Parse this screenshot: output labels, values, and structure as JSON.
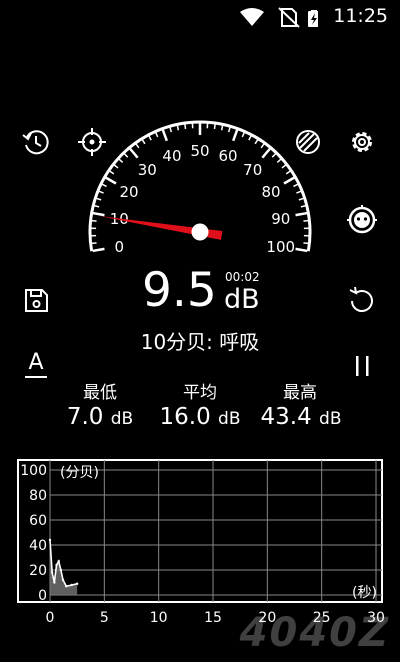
{
  "status_bar": {
    "time": "11:25",
    "icons": [
      "wifi-icon",
      "no-sim-icon",
      "battery-charging-icon"
    ]
  },
  "toolbar": {
    "left_icons": [
      "history-icon",
      "target-icon",
      "save-icon",
      "a-weighting-icon"
    ],
    "right_icons": [
      "theme-icon",
      "gear-icon",
      "calibrate-icon",
      "reset-icon",
      "pause-icon"
    ],
    "a_weighting_label": "A"
  },
  "gauge": {
    "ticks": [
      "0",
      "10",
      "20",
      "30",
      "40",
      "50",
      "60",
      "70",
      "80",
      "90",
      "100"
    ],
    "needle_value": 9.5,
    "needle_color": "#e0101a"
  },
  "reading": {
    "value": "9.5",
    "unit": "dB",
    "elapsed": "00:02",
    "description": "10分贝: 呼吸"
  },
  "stats": {
    "min": {
      "label": "最低",
      "value": "7.0",
      "unit": "dB"
    },
    "avg": {
      "label": "平均",
      "value": "16.0",
      "unit": "dB"
    },
    "max": {
      "label": "最高",
      "value": "43.4",
      "unit": "dB"
    }
  },
  "chart_data": {
    "type": "area",
    "ylabel": "(分贝)",
    "xlabel": "(秒)",
    "y_ticks": [
      "100",
      "80",
      "60",
      "40",
      "20",
      "0"
    ],
    "x_ticks": [
      "0",
      "5",
      "10",
      "15",
      "20",
      "25",
      "30"
    ],
    "ylim": [
      0,
      100
    ],
    "xlim": [
      0,
      30
    ],
    "grid": true,
    "x": [
      0,
      0.2,
      0.4,
      0.6,
      0.8,
      1.0,
      1.2,
      1.5,
      2.0,
      2.5
    ],
    "values": [
      44,
      18,
      10,
      24,
      27,
      20,
      12,
      7,
      8,
      9
    ]
  },
  "watermark": "4040Z"
}
